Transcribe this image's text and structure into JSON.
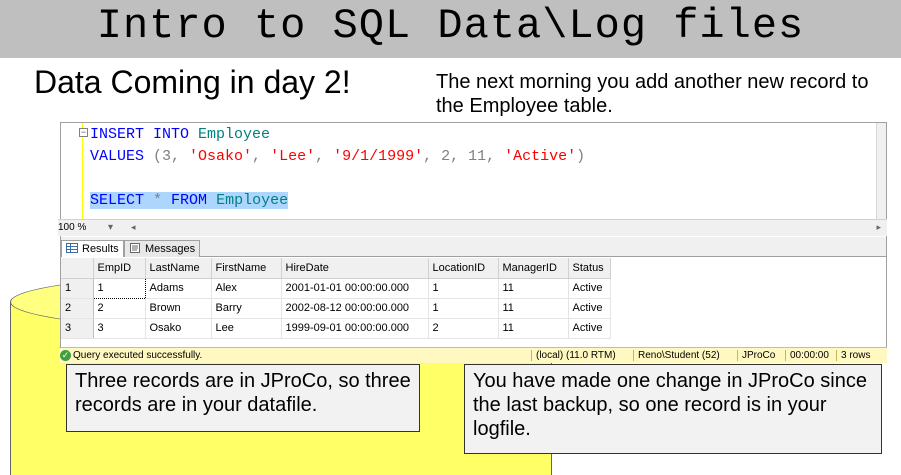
{
  "slide": {
    "title": "Intro to SQL Data\\Log files",
    "subtitle": "Data Coming in day 2!",
    "intro": "The next morning you add another new record to the Employee  table."
  },
  "editor": {
    "line1_kw": "INSERT INTO",
    "line1_tbl": "Employee",
    "line2_kw": "VALUES",
    "line2_open": " (3, ",
    "line2_s1": "'Osako'",
    "line2_c1": ", ",
    "line2_s2": "'Lee'",
    "line2_c2": ", ",
    "line2_s3": "'9/1/1999'",
    "line2_mid": ", 2, 11, ",
    "line2_s4": "'Active'",
    "line2_close": ")",
    "line3_kw1": "SELECT",
    "line3_star": " * ",
    "line3_kw2": "FROM",
    "line3_tbl": "Employee",
    "zoom": "100 %"
  },
  "tabs": [
    {
      "label": "Results"
    },
    {
      "label": "Messages"
    }
  ],
  "grid": {
    "columns": [
      "EmpID",
      "LastName",
      "FirstName",
      "HireDate",
      "LocationID",
      "ManagerID",
      "Status"
    ],
    "rows": [
      {
        "n": "1",
        "cells": [
          "1",
          "Adams",
          "Alex",
          "2001-01-01 00:00:00.000",
          "1",
          "11",
          "Active"
        ]
      },
      {
        "n": "2",
        "cells": [
          "2",
          "Brown",
          "Barry",
          "2002-08-12 00:00:00.000",
          "1",
          "11",
          "Active"
        ]
      },
      {
        "n": "3",
        "cells": [
          "3",
          "Osako",
          "Lee",
          "1999-09-01 00:00:00.000",
          "2",
          "11",
          "Active"
        ]
      }
    ]
  },
  "status_bar": {
    "message": "Query executed successfully.",
    "server": "(local) (11.0 RTM)",
    "user": "Reno\\Student (52)",
    "database": "JProCo",
    "time": "00:00:00",
    "rows": "3 rows"
  },
  "callouts": {
    "left": "Three records are in JProCo, so three records are in your datafile.",
    "right": "You have made one change in JProCo since the last backup, so one record is in your logfile."
  },
  "colors": {
    "title_band": "#bfbfbf",
    "cylinder": "#ffff66",
    "keyword": "#0000ff",
    "table_name": "#008080",
    "string": "#ff0000",
    "status_bar": "#fff8c0"
  }
}
